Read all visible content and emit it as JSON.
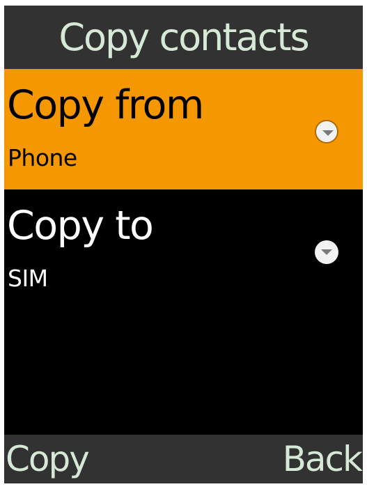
{
  "header": {
    "title": "Copy contacts"
  },
  "list": {
    "items": [
      {
        "label": "Copy from",
        "value": "Phone",
        "selected": true,
        "icon": "chevron-down-circle-icon"
      },
      {
        "label": "Copy to",
        "value": "SIM",
        "selected": false,
        "icon": "chevron-down-circle-icon"
      }
    ]
  },
  "softkeys": {
    "left_label": "Copy",
    "right_label": "Back"
  },
  "colors": {
    "header_background": "#323232",
    "header_text": "#d6e9d6",
    "selected_background": "#f59700",
    "selected_text": "#000000",
    "unselected_background": "#000000",
    "unselected_text": "#ffffff",
    "icon_fill": "#f2f2f2",
    "icon_arrow": "#7a7a7a"
  }
}
